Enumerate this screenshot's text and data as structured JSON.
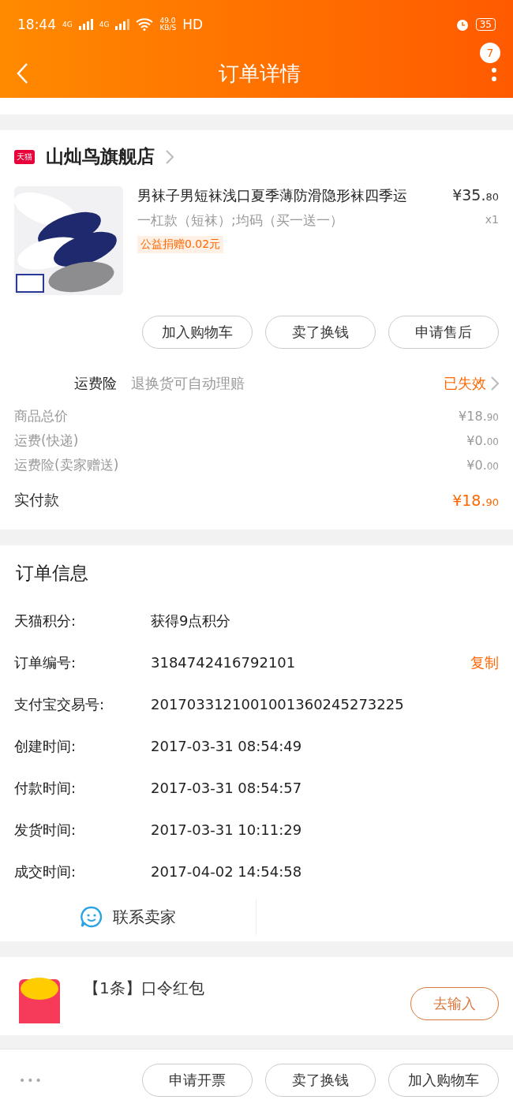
{
  "status_bar": {
    "time": "18:44",
    "network_1": "4G",
    "network_2": "4G",
    "speed": "49.0",
    "speed_unit": "KB/S",
    "hd": "HD",
    "battery": "35"
  },
  "header": {
    "title": "订单详情",
    "badge": "7"
  },
  "store": {
    "badge": "天猫",
    "name": "山灿鸟旗舰店"
  },
  "product": {
    "title": "男袜子男短袜浅口夏季薄防滑隐形袜四季运",
    "spec": "一杠款（短袜）;均码（买一送一）",
    "tag": "公益捐赠0.02元",
    "price_symbol": "¥",
    "price_int": "35.",
    "price_dec": "80",
    "qty": "x1"
  },
  "item_actions": [
    "加入购物车",
    "卖了换钱",
    "申请售后"
  ],
  "insurance": {
    "label": "运费险",
    "desc": "退换货可自动理赔",
    "status": "已失效"
  },
  "costs": [
    {
      "label": "商品总价",
      "int": "¥18.",
      "dec": "90"
    },
    {
      "label": "运费(快递)",
      "int": "¥0.",
      "dec": "00"
    },
    {
      "label": "运费险(卖家赠送)",
      "int": "¥0.",
      "dec": "00"
    }
  ],
  "total": {
    "label": "实付款",
    "int": "¥18.",
    "dec": "90"
  },
  "order_info": {
    "title": "订单信息",
    "rows": [
      {
        "label": "天猫积分:",
        "value": "获得9点积分"
      },
      {
        "label": "订单编号:",
        "value": "3184742416792101",
        "action": "复制"
      },
      {
        "label": "支付宝交易号:",
        "value": "2017033121001001360245273225"
      },
      {
        "label": "创建时间:",
        "value": "2017-03-31 08:54:49"
      },
      {
        "label": "付款时间:",
        "value": "2017-03-31 08:54:57"
      },
      {
        "label": "发货时间:",
        "value": "2017-03-31 10:11:29"
      },
      {
        "label": "成交时间:",
        "value": "2017-04-02 14:54:58"
      }
    ],
    "contact": "联系卖家"
  },
  "red_packet": {
    "title": "【1条】口令红包",
    "action": "去输入"
  },
  "bottom_bar": {
    "more": "•••",
    "buttons": [
      "申请开票",
      "卖了换钱",
      "加入购物车"
    ]
  }
}
